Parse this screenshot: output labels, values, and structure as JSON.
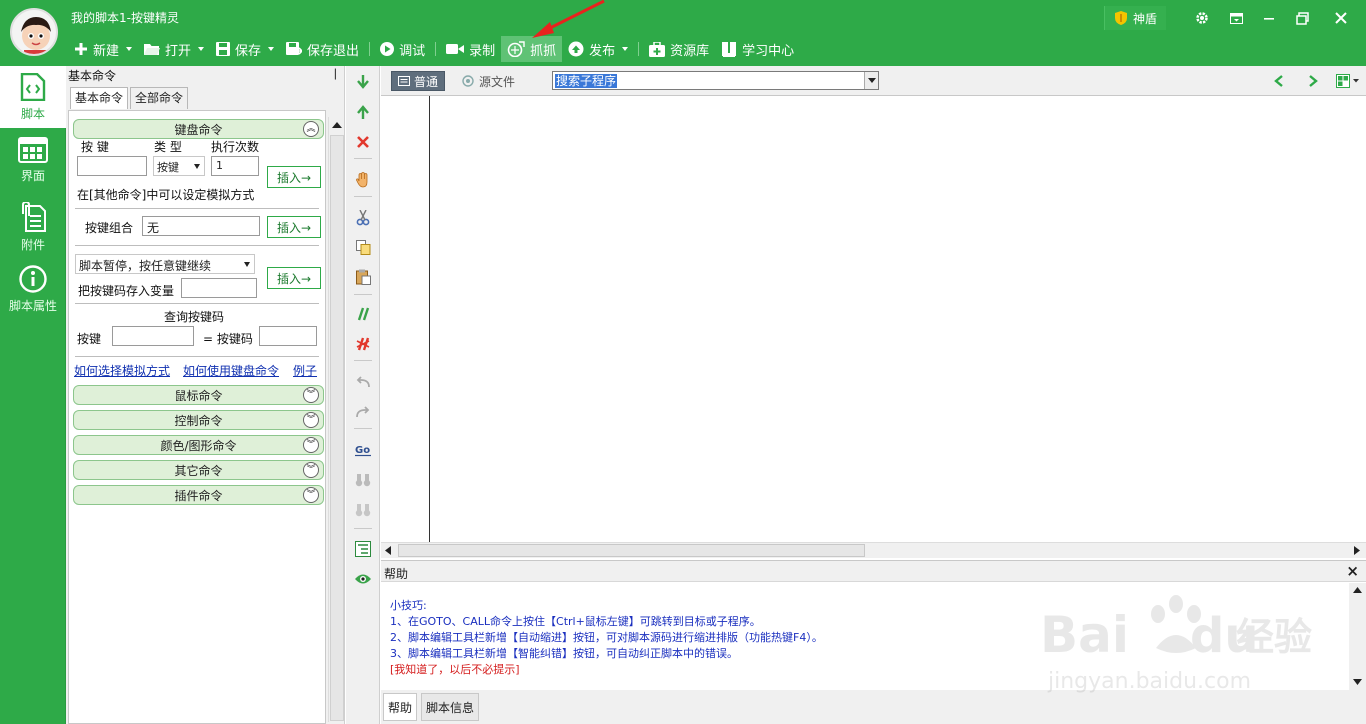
{
  "window": {
    "title": "我的脚本1-按键精灵",
    "shield_label": "神盾"
  },
  "toolbar": {
    "items": [
      {
        "label": "新建",
        "icon": "plus-icon",
        "caret": true
      },
      {
        "label": "打开",
        "icon": "folder-icon",
        "caret": true
      },
      {
        "label": "保存",
        "icon": "save-icon",
        "caret": true
      },
      {
        "label": "保存退出",
        "icon": "save-exit-icon",
        "caret": false
      },
      {
        "label": "调试",
        "icon": "play-icon",
        "caret": false
      },
      {
        "label": "录制",
        "icon": "video-camera-icon",
        "caret": false
      },
      {
        "label": "抓抓",
        "icon": "capture-icon",
        "caret": false,
        "active": true
      },
      {
        "label": "发布",
        "icon": "publish-icon",
        "caret": true
      },
      {
        "label": "资源库",
        "icon": "resource-icon",
        "caret": false
      },
      {
        "label": "学习中心",
        "icon": "book-icon",
        "caret": false
      }
    ]
  },
  "sidebar": {
    "items": [
      {
        "label": "脚本",
        "icon": "script-icon"
      },
      {
        "label": "界面",
        "icon": "ui-icon"
      },
      {
        "label": "附件",
        "icon": "attachment-icon"
      },
      {
        "label": "脚本属性",
        "icon": "info-icon"
      }
    ]
  },
  "cmd_panel": {
    "title": "基本命令",
    "pin": "ᵖ",
    "tabs": [
      "基本命令",
      "全部命令"
    ],
    "keyboard": {
      "group_title": "键盘命令",
      "key_label": "按 键",
      "type_label": "类 型",
      "count_label": "执行次数",
      "type_value": "按键",
      "count_value": "1",
      "insert": "插入→",
      "note": "在[其他命令]中可以设定模拟方式",
      "combo_label": "按键组合",
      "combo_value": "无",
      "pause_select": "脚本暂停，按任意键继续",
      "store_label": "把按键码存入变量",
      "query_title": "查询按键码",
      "query_key_label": "按键",
      "query_code_label": "= 按键码",
      "links": [
        "如何选择模拟方式",
        "如何使用键盘命令",
        "例子"
      ]
    },
    "groups": [
      "鼠标命令",
      "控制命令",
      "颜色/图形命令",
      "其它命令",
      "插件命令"
    ]
  },
  "editor": {
    "mode_tabs": [
      "普通",
      "源文件"
    ],
    "search_placeholder": "搜索子程序"
  },
  "help": {
    "title": "帮助",
    "close": "×",
    "tips_title": "小技巧:",
    "lines": [
      "1、在GOTO、CALL命令上按住【Ctrl+鼠标左键】可跳转到目标或子程序。",
      "2、脚本编辑工具栏新增【自动缩进】按钮，可对脚本源码进行缩进排版（功能热键F4）。",
      "3、脚本编辑工具栏新增【智能纠错】按钮，可自动纠正脚本中的错误。"
    ],
    "dismiss": "[我知道了，以后不必提示]",
    "tabs": [
      "帮助",
      "脚本信息"
    ]
  },
  "watermark": {
    "brand": "Bai",
    "brand2": "du",
    "cn": "经验",
    "url": "jingyan.baidu.com"
  },
  "colors": {
    "brand_green": "#2eaa48",
    "help_text": "#1a2fbf",
    "dismiss_red": "#d41c1c"
  }
}
